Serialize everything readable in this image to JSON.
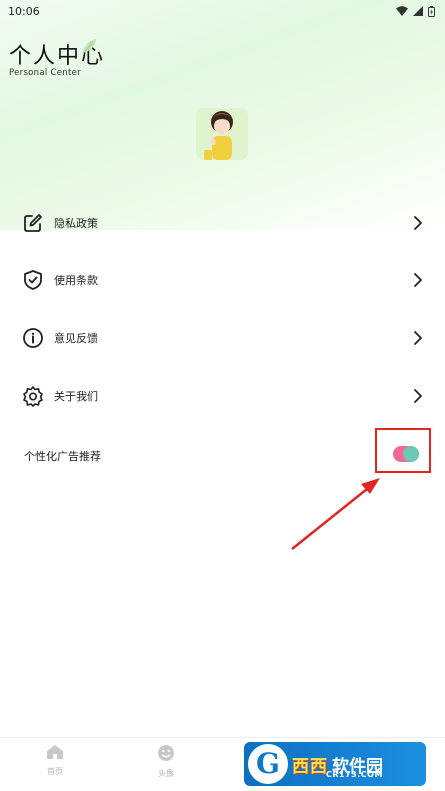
{
  "status_bar": {
    "time": "10:06"
  },
  "header": {
    "title": "个人中心",
    "subtitle": "Personal Center"
  },
  "menu": {
    "items": [
      {
        "label": "隐私政策",
        "icon": "edit-icon"
      },
      {
        "label": "使用条款",
        "icon": "shield-icon"
      },
      {
        "label": "意见反馈",
        "icon": "info-icon"
      },
      {
        "label": "关于我们",
        "icon": "gear-icon"
      }
    ]
  },
  "ad_setting": {
    "label": "个性化广告推荐",
    "enabled": true
  },
  "bottom_nav": {
    "items": [
      {
        "label": "首页",
        "icon": "home-icon"
      },
      {
        "label": "头像",
        "icon": "smile-icon"
      }
    ]
  },
  "watermark": {
    "brand": "西西",
    "brand2": "软件园",
    "url": "CR173.COM"
  },
  "colors": {
    "highlight": "#e0261e",
    "toggle_track": "#f06a8f",
    "toggle_knob": "#6cc7b9"
  }
}
